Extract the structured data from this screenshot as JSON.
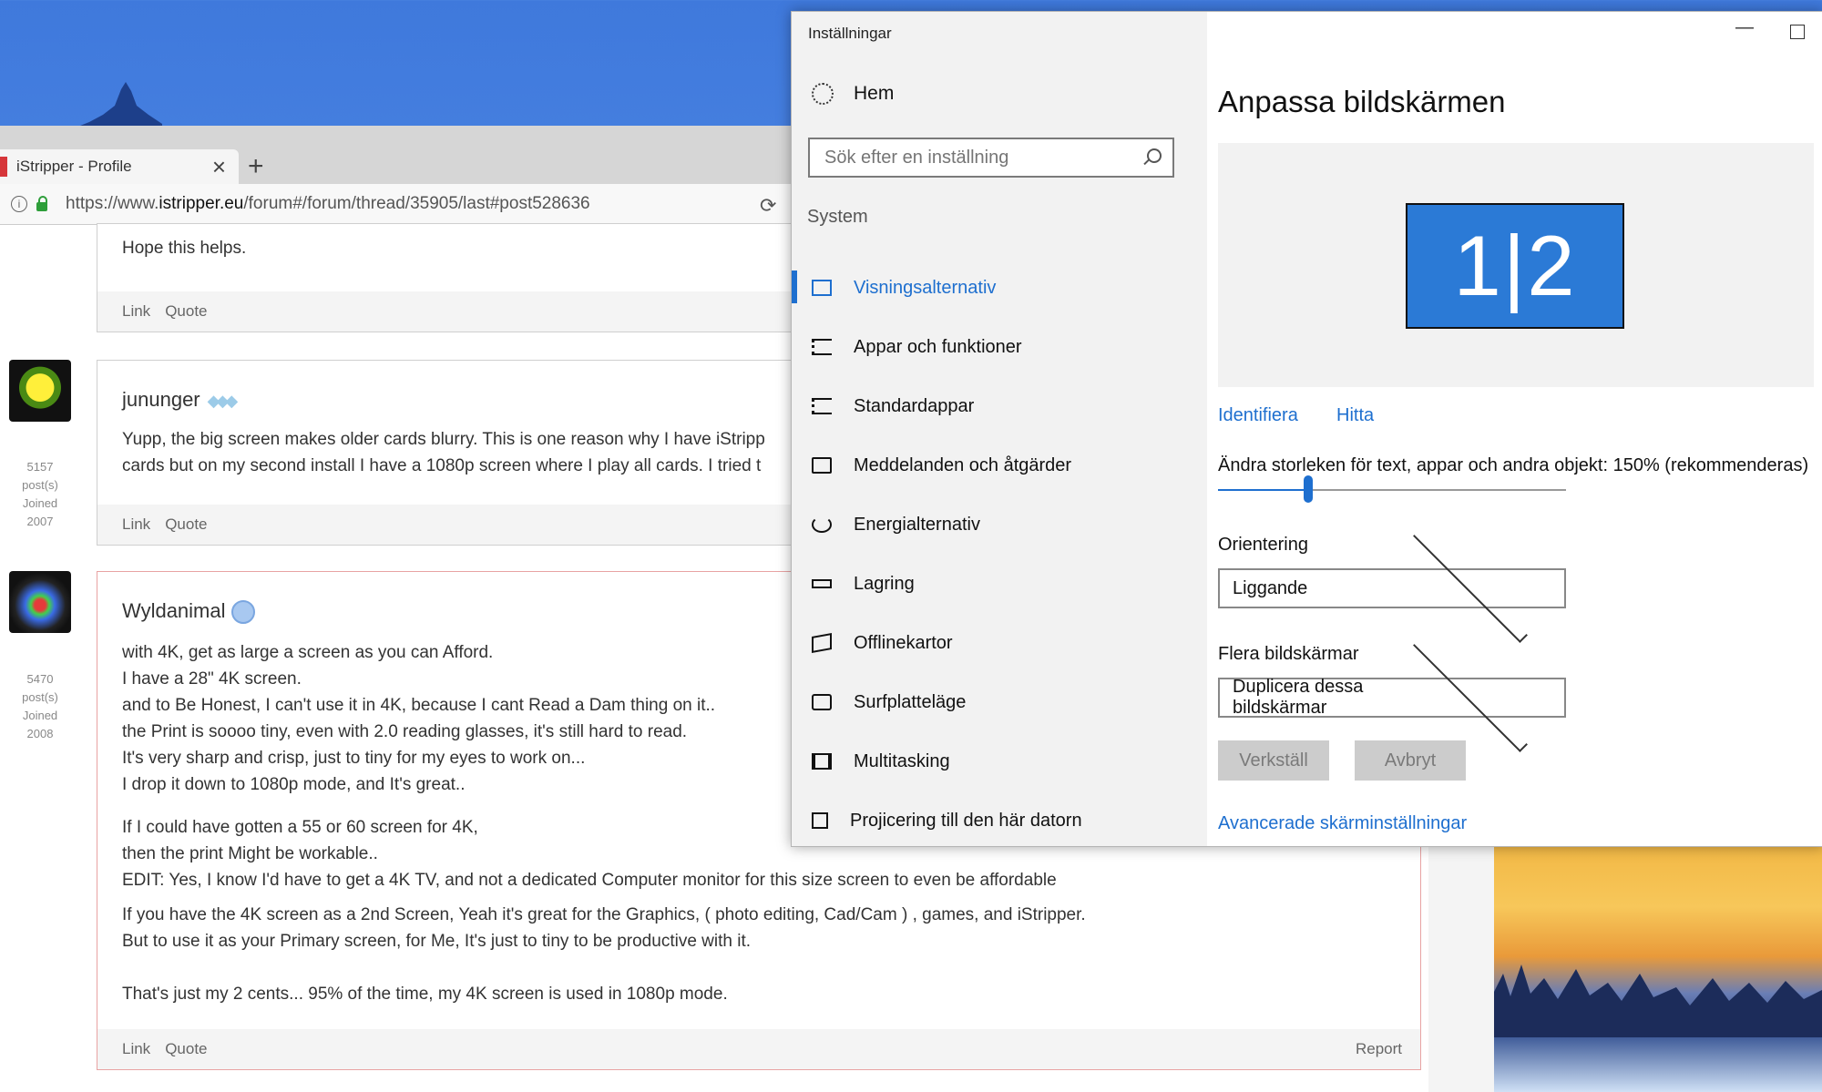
{
  "browser": {
    "tab_title": "iStripper - Profile",
    "new_tab": "+",
    "url_prefix": "https://www.",
    "url_domain": "istripper.eu",
    "url_path": "/forum#/forum/thread/35905/last#post528636"
  },
  "posts": [
    {
      "lines": "Hope this helps.",
      "link": "Link",
      "quote": "Quote"
    },
    {
      "author": "jununger",
      "posts": "5157",
      "posts_label": "post(s)",
      "joined_label": "Joined",
      "joined": "2007",
      "lines": "Yupp, the big screen makes older cards blurry. This is one reason why I have iStripp\ncards but on my second install I have a 1080p screen where I play all cards. I tried t",
      "link": "Link",
      "quote": "Quote"
    },
    {
      "author": "Wyldanimal",
      "posts": "5470",
      "posts_label": "post(s)",
      "joined_label": "Joined",
      "joined": "2008",
      "para1": "with 4K, get as large a screen as you can Afford.\nI have a 28\" 4K screen.\nand to Be Honest, I can't use it in 4K, because I cant Read a Dam thing on it..\nthe Print is soooo tiny, even with 2.0 reading glasses, it's still hard to read.\nIt's very sharp and crisp, just to tiny for my eyes to work on...\nI drop it down to 1080p mode, and It's great..",
      "para2": "If I could have gotten a 55 or 60 screen for 4K,\nthen the print Might be workable..\nEDIT: Yes, I know I'd have to get a 4K TV, and not a dedicated Computer monitor for this size screen to even be affordable",
      "para3": "If you have the 4K screen as a 2nd Screen, Yeah it's great for the Graphics, ( photo editing, Cad/Cam ) , games, and iStripper.\nBut to use it as your Primary screen, for Me, It's just to tiny to be productive with it.\n\nThat's just my 2 cents... 95% of the time, my 4K screen is used in 1080p mode.",
      "link": "Link",
      "quote": "Quote",
      "report": "Report"
    }
  ],
  "settings": {
    "window_title": "Inställningar",
    "home": "Hem",
    "search_placeholder": "Sök efter en inställning",
    "section": "System",
    "nav_items": [
      {
        "label": "Visningsalternativ",
        "icon": "display-icon"
      },
      {
        "label": "Appar och funktioner",
        "icon": "apps-list-icon"
      },
      {
        "label": "Standardappar",
        "icon": "default-apps-icon"
      },
      {
        "label": "Meddelanden och åtgärder",
        "icon": "notifications-icon"
      },
      {
        "label": "Energialternativ",
        "icon": "power-icon"
      },
      {
        "label": "Lagring",
        "icon": "storage-icon"
      },
      {
        "label": "Offlinekartor",
        "icon": "map-icon"
      },
      {
        "label": "Surfplatteläge",
        "icon": "tablet-icon"
      },
      {
        "label": "Multitasking",
        "icon": "multitasking-icon"
      },
      {
        "label": "Projicering till den här datorn",
        "icon": "projecting-icon"
      }
    ],
    "page_title": "Anpassa bildskärmen",
    "monitor_label": "1|2",
    "identify": "Identifiera",
    "detect": "Hitta",
    "scale_label": "Ändra storleken för text, appar och andra objekt: 150% (rekommenderas)",
    "scale_slider_fraction": 0.26,
    "orientation_label": "Orientering",
    "orientation_value": "Liggande",
    "multi_label": "Flera bildskärmar",
    "multi_value": "Duplicera dessa bildskärmar",
    "apply": "Verkställ",
    "cancel": "Avbryt",
    "advanced": "Avancerade skärminställningar",
    "accent_color": "#1e6fcf"
  }
}
